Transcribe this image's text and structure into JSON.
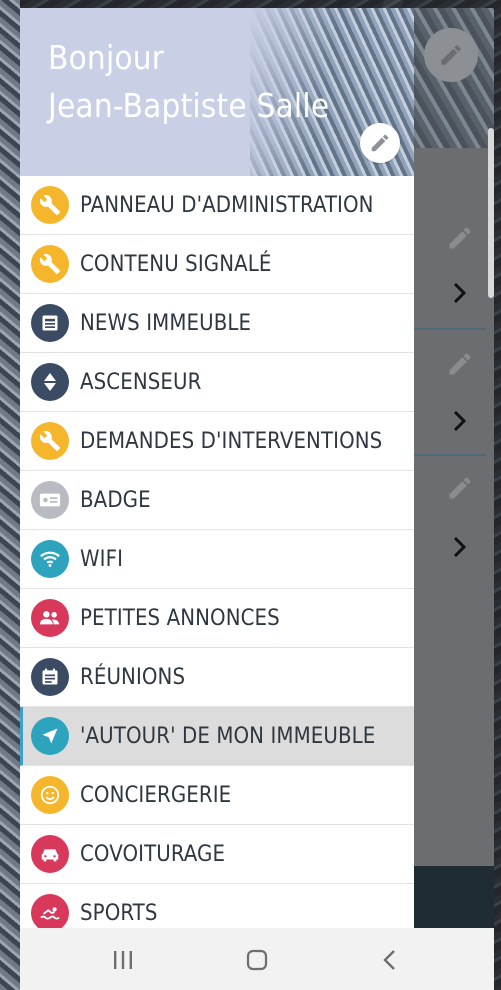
{
  "header": {
    "greeting_line1": "Bonjour",
    "greeting_line2": "Jean-Baptiste Salle",
    "edit_icon": "pencil-icon"
  },
  "menu": {
    "items": [
      {
        "label": "PANNEAU D'ADMINISTRATION",
        "icon": "wrench-icon",
        "color": "#f5b62b"
      },
      {
        "label": "CONTENU SIGNALÉ",
        "icon": "wrench-icon",
        "color": "#f5b62b"
      },
      {
        "label": "NEWS IMMEUBLE",
        "icon": "news-icon",
        "color": "#3b4b63"
      },
      {
        "label": "ASCENSEUR",
        "icon": "elevator-icon",
        "color": "#3b4b63"
      },
      {
        "label": "DEMANDES D'INTERVENTIONS",
        "icon": "wrench-icon",
        "color": "#f5b62b"
      },
      {
        "label": "BADGE",
        "icon": "badge-icon",
        "color": "#b8bcc2"
      },
      {
        "label": "WIFI",
        "icon": "wifi-icon",
        "color": "#2da3be"
      },
      {
        "label": "PETITES ANNONCES",
        "icon": "people-icon",
        "color": "#d8395b"
      },
      {
        "label": "RÉUNIONS",
        "icon": "calendar-icon",
        "color": "#3b4b63"
      },
      {
        "label": "'AUTOUR' DE MON IMMEUBLE",
        "icon": "navigation-icon",
        "color": "#2da3be",
        "active": true
      },
      {
        "label": "CONCIERGERIE",
        "icon": "smiley-icon",
        "color": "#f5b62b"
      },
      {
        "label": "COVOITURAGE",
        "icon": "car-icon",
        "color": "#d8395b"
      },
      {
        "label": "SPORTS",
        "icon": "swim-icon",
        "color": "#d8395b"
      }
    ]
  },
  "navbar": {
    "recent_icon": "recent-apps-icon",
    "home_icon": "home-icon",
    "back_icon": "back-icon"
  },
  "colors": {
    "header_bg": "#c9d0e6",
    "active_item_bg": "#dcdcdc",
    "accent": "#3fa0c9"
  }
}
